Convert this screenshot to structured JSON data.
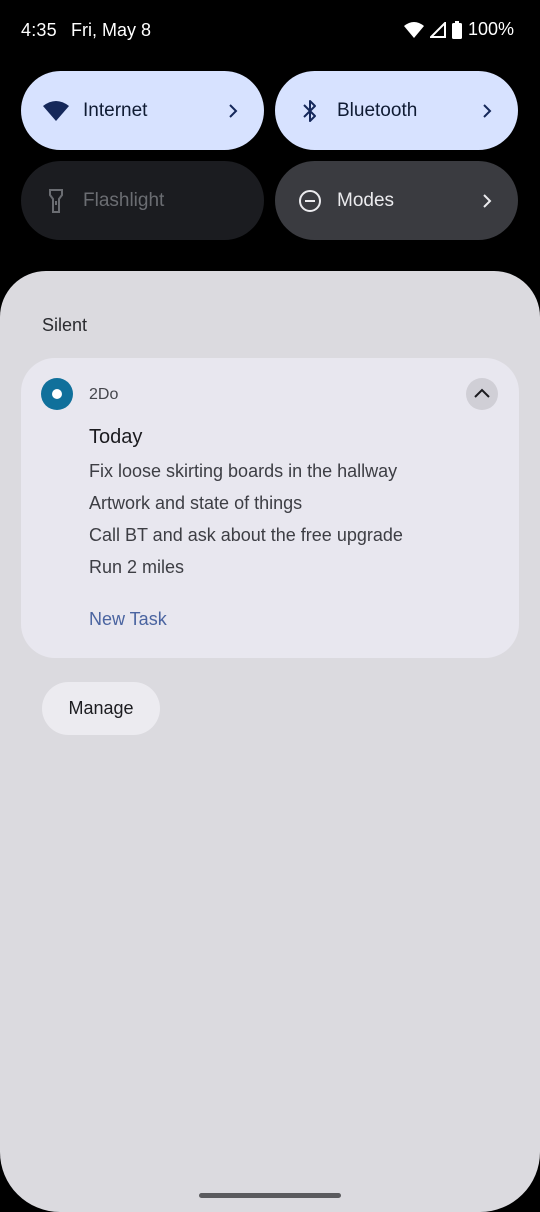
{
  "status_bar": {
    "time": "4:35",
    "date": "Fri, May 8",
    "battery": "100%",
    "icons": [
      "wifi-icon",
      "cellular-signal-icon",
      "battery-icon"
    ]
  },
  "quick_settings": {
    "tiles": [
      {
        "label": "Internet",
        "icon": "wifi-icon",
        "state": "active",
        "has_chevron": true
      },
      {
        "label": "Bluetooth",
        "icon": "bluetooth-icon",
        "state": "active",
        "has_chevron": true
      },
      {
        "label": "Flashlight",
        "icon": "flashlight-icon",
        "state": "unavailable",
        "has_chevron": false
      },
      {
        "label": "Modes",
        "icon": "modes-icon",
        "state": "inactive",
        "has_chevron": true
      }
    ]
  },
  "shade": {
    "section_label": "Silent",
    "notification": {
      "app_name": "2Do",
      "title": "Today",
      "tasks": [
        "Fix loose skirting boards in the hallway",
        "Artwork and state of things",
        "Call BT and ask about the free upgrade",
        "Run 2 miles"
      ],
      "action_label": "New Task"
    },
    "manage_label": "Manage"
  },
  "colors": {
    "accent_tile": "#d7e2ff",
    "app_icon": "#10709b",
    "action_text": "#4a64a0",
    "shade_bg": "#dbdadf"
  }
}
